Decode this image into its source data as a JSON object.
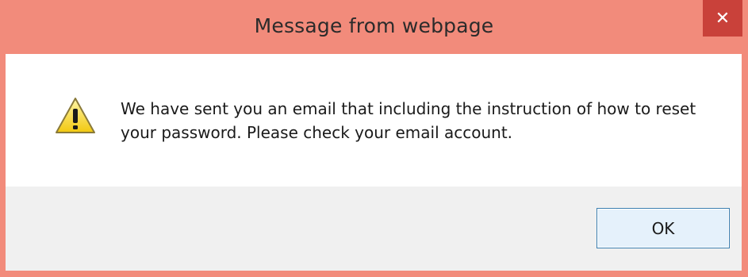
{
  "window": {
    "title": "Message from webpage",
    "close_glyph": "✕",
    "title_bar_color": "#f28b7b",
    "close_button_color": "#c9413a"
  },
  "dialog": {
    "icon": "warning-icon",
    "message": "We have sent you an email that including the instruction of how to reset your password. Please check your email account.",
    "ok_label": "OK"
  }
}
